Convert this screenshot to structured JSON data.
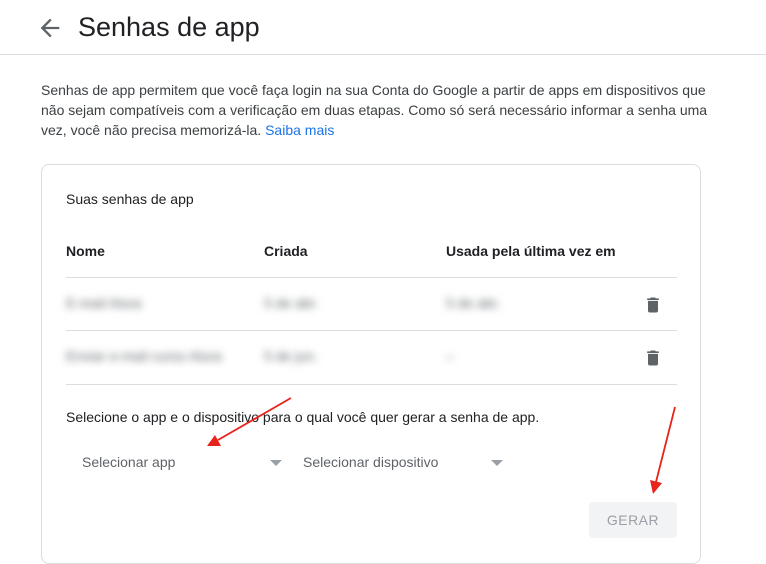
{
  "header": {
    "back_icon": "arrow-left-icon",
    "title": "Senhas de app"
  },
  "description": {
    "text": "Senhas de app permitem que você faça login na sua Conta do Google a partir de apps em dispositivos que não sejam compatíveis com a verificação em duas etapas. Como só será necessário informar a senha uma vez, você não precisa memorizá-la.",
    "link": "Saiba mais",
    "link_color": "#1a73e8"
  },
  "card": {
    "title": "Suas senhas de app",
    "columns": [
      "Nome",
      "Criada",
      "Usada pela última vez em"
    ],
    "rows": [
      {
        "name": "E-mail Alura",
        "created": "5 de abr.",
        "last_used": "5 de abr.",
        "action_icon": "trash-icon"
      },
      {
        "name": "Enviar e-mail curso Alura",
        "created": "5 de jun.",
        "last_used": "–",
        "action_icon": "trash-icon"
      }
    ],
    "instruction": "Selecione o app e o dispositivo para o qual você quer gerar a senha de app.",
    "select_app": "Selecionar app",
    "select_device": "Selecionar dispositivo",
    "generate_button": "GERAR"
  },
  "annotations": {
    "arrow_color": "#e8231c"
  }
}
